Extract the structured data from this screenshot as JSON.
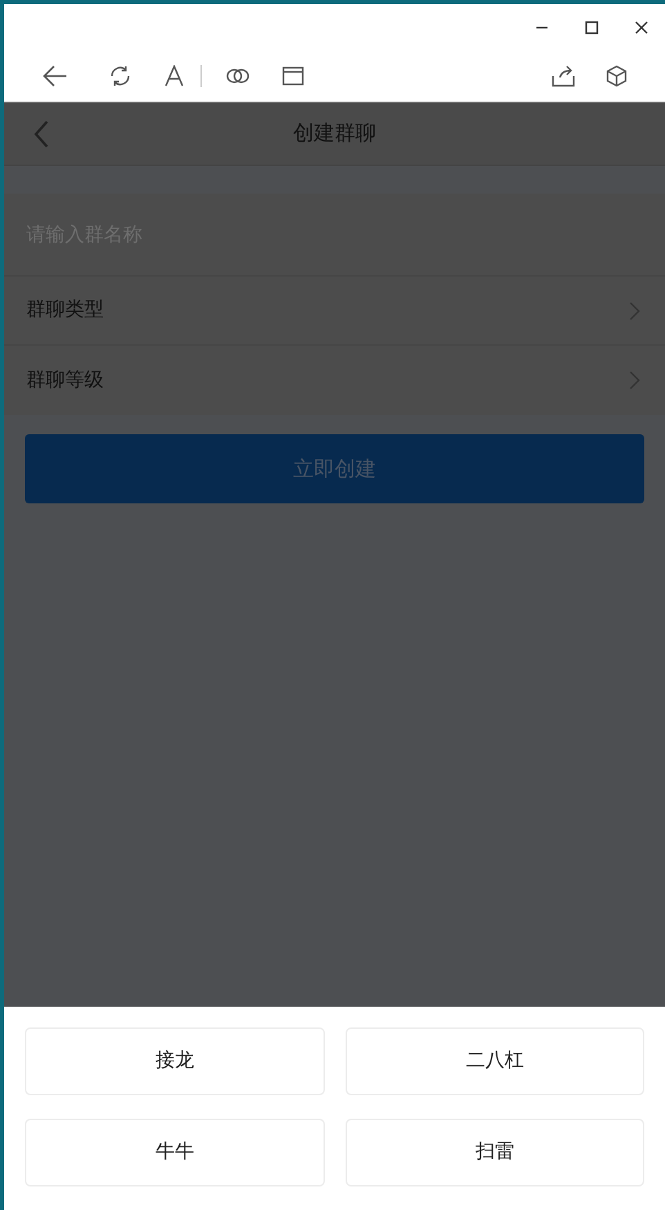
{
  "page": {
    "title": "创建群聊"
  },
  "name_field": {
    "placeholder": "请输入群名称"
  },
  "settings": [
    {
      "label": "群聊类型"
    },
    {
      "label": "群聊等级"
    }
  ],
  "create_button": {
    "label": "立即创建"
  },
  "action_sheet": {
    "options": [
      {
        "label": "接龙"
      },
      {
        "label": "二八杠"
      },
      {
        "label": "牛牛"
      },
      {
        "label": "扫雷"
      }
    ]
  }
}
